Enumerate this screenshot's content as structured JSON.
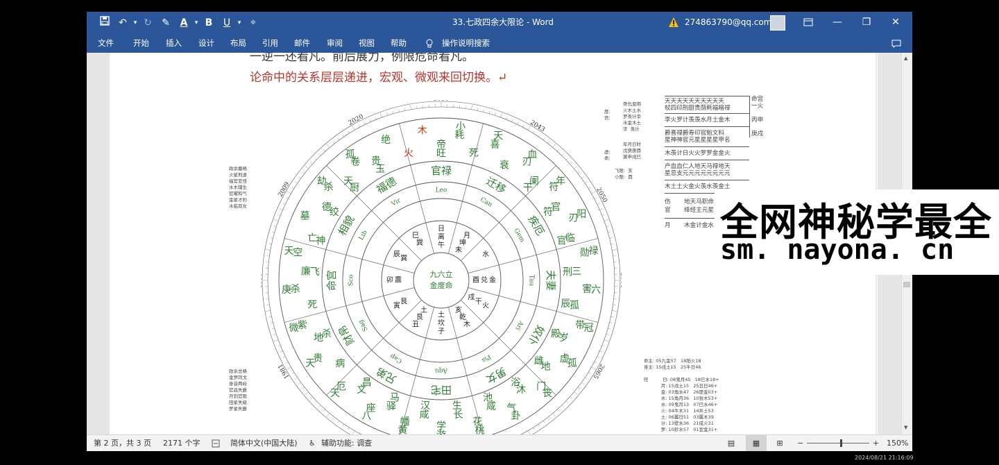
{
  "window": {
    "title": "33.七政四余大限论  -  Word",
    "account": "274863790@qq.com"
  },
  "ribbon": {
    "tabs": [
      "文件",
      "开始",
      "插入",
      "设计",
      "布局",
      "引用",
      "邮件",
      "审阅",
      "视图",
      "帮助",
      "操作说明搜索"
    ]
  },
  "document": {
    "para_top": "一逆一还看凡。前后展力，例限危命看凡。",
    "para_red": "论命中的关系层层递进，宏观、微观来回切换。↵"
  },
  "chart": {
    "year_labels": [
      "2035",
      "2020",
      "2043",
      "2009",
      "2050",
      "1999",
      "2061",
      "1981",
      "2065"
    ],
    "center_text": [
      "九六立",
      "金度命"
    ],
    "outer_ring": [
      "帝旺",
      "小耗",
      "死",
      "天喜",
      "衰",
      "血刃",
      "阑干",
      "年符",
      "官符",
      "阳刃",
      "临官",
      "禄勋",
      "三刑",
      "六害",
      "孤辰",
      "冠带",
      "岁殿",
      "孤虚",
      "地雌",
      "丧门",
      "沐浴",
      "卦气",
      "咸池",
      "桃花",
      "长生",
      "游学",
      "咸汉",
      "黄幡",
      "驿马",
      "八座",
      "文昌",
      "天厄",
      "病",
      "天贵",
      "地杀",
      "微紫",
      "死",
      "庚杀",
      "廉飞",
      "天空",
      "亡神",
      "墓",
      "德绞",
      "劫杀",
      "天厨",
      "孤卷",
      "贵玉",
      "绝",
      "火",
      "木"
    ],
    "zodiac_labels": [
      "Leo",
      "Can",
      "Gem",
      "Tau",
      "Ari",
      "Pis",
      "Aqu",
      "Cap",
      "Sag",
      "Sco",
      "Lib",
      "Vir"
    ],
    "palace_labels": [
      "官禄",
      "迁移",
      "疾厄",
      "夫妻",
      "奴仆",
      "男女",
      "田宅",
      "兄弟",
      "财帛",
      "命宫",
      "相貌",
      "福德"
    ],
    "inner_cells": [
      "日\n离\n午",
      "月\n坤\n未",
      "水",
      "金\n兑\n酉",
      "火\n干\n戌",
      "木\n乾\n亥",
      "子\n坎\n土",
      "丑\n艮\n土",
      "寅\n艮",
      "卯\n震",
      "辰\n巽",
      "巳\n巽"
    ]
  },
  "side_notes": {
    "top_right": "骨仇恩用\n火木土水\n罗羡计孛\n水金木土\n孛  羡计",
    "top_right_labels": "度:\n宫:",
    "mid_right": "年月日时\n戊庚庚酉\n寅申戌巳",
    "mid_right_labels": "虚:\n命:",
    "fly": "飞限:  亥\n小限:  酉",
    "left_top": "政余墓格\n火星刑退\n福官亚怪\n水木辅生\n官曜和气\n金星才豹\n水临双女",
    "left_bottom": "政余总格\n金罗同戈\n身皆两岐\n官昌失爵\n月到官限\n田星失级\n罗星失爵",
    "bottom_right": "命主: 05九金57   18阳火18\n身主: 15戌土15   25牛日46\n\n旺          日: 08鬼月45   18巳水18+\n            月: 15戌土15   25丑日46+\n            金: 03角水47   26度金03+\n            木: 15角月36   10张木53+\n            水: 09鬼月13   07巳水46+\n            火: 04牛木31   14井土53\n            土: 06翼日51   03翼木39\n            计: 13壁水36   21成火31\n            罗: 10轸水57   01室金31+"
  },
  "table_grid": {
    "row1": "天天天天天天天天天天\n杖四印刑厨贵荫耗福暗禄",
    "row2": "李火罗计羡羡水月土金木",
    "row3": "爵喜禄爵寿印官魁文科\n星神神官元星星星星甲名",
    "row4": "木羡计日火火罗罗金金火",
    "row5": "产血血仁人地天马禄地天\n星忌支元元元元元元元元",
    "row6": "木土土火金火羡水羡金土",
    "row7_left": "伤\n官",
    "row7": "地天马职命\n绛经主元星",
    "row8_left": "月",
    "row8": "木金计金水",
    "side_right": "命宫\n一火\n\n丙申\n\n庚戌"
  },
  "watermark": {
    "line1": "全网神秘学最全",
    "line2": "sm. nayona. cn"
  },
  "statusbar": {
    "page": "第 2 页，共 3 页",
    "words": "2171 个字",
    "language": "简体中文(中国大陆)",
    "accessibility": "辅助功能: 调查",
    "zoom": "150%"
  },
  "clock": "2024/08/21 21:16:09",
  "colors": {
    "accent": "#2b579a",
    "chart_green": "#2e7d32",
    "red_text": "#b8342c"
  }
}
